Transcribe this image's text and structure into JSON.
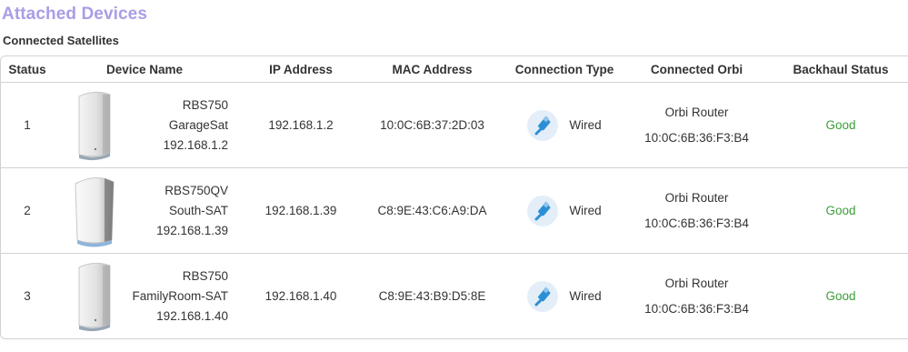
{
  "page": {
    "title": "Attached Devices",
    "section_title": "Connected Satellites"
  },
  "table": {
    "headers": [
      "Status",
      "Device Name",
      "IP Address",
      "MAC Address",
      "Connection Type",
      "Connected Orbi",
      "Backhaul Status"
    ],
    "rows": [
      {
        "status": "1",
        "model": "RBS750",
        "name": "GarageSat",
        "device_ip": "192.168.1.2",
        "ip": "192.168.1.2",
        "mac": "10:0C:6B:37:2D:03",
        "connection": "Wired",
        "orbi_name": "Orbi Router",
        "orbi_mac": "10:0C:6B:36:F3:B4",
        "backhaul": "Good",
        "icon": "orbi-satellite-rbs750-icon"
      },
      {
        "status": "2",
        "model": "RBS750QV",
        "name": "South-SAT",
        "device_ip": "192.168.1.39",
        "ip": "192.168.1.39",
        "mac": "C8:9E:43:C6:A9:DA",
        "connection": "Wired",
        "orbi_name": "Orbi Router",
        "orbi_mac": "10:0C:6B:36:F3:B4",
        "backhaul": "Good",
        "icon": "orbi-satellite-rbs750qv-icon"
      },
      {
        "status": "3",
        "model": "RBS750",
        "name": "FamilyRoom-SAT",
        "device_ip": "192.168.1.40",
        "ip": "192.168.1.40",
        "mac": "C8:9E:43:B9:D5:8E",
        "connection": "Wired",
        "orbi_name": "Orbi Router",
        "orbi_mac": "10:0C:6B:36:F3:B4",
        "backhaul": "Good",
        "icon": "orbi-satellite-rbs750-icon"
      }
    ]
  },
  "colors": {
    "title": "#a89ee6",
    "good": "#3b9e3b",
    "wired_icon_bg": "#e3eef8",
    "wired_icon_fg": "#2b8fd6",
    "border": "#d2d2d2"
  }
}
